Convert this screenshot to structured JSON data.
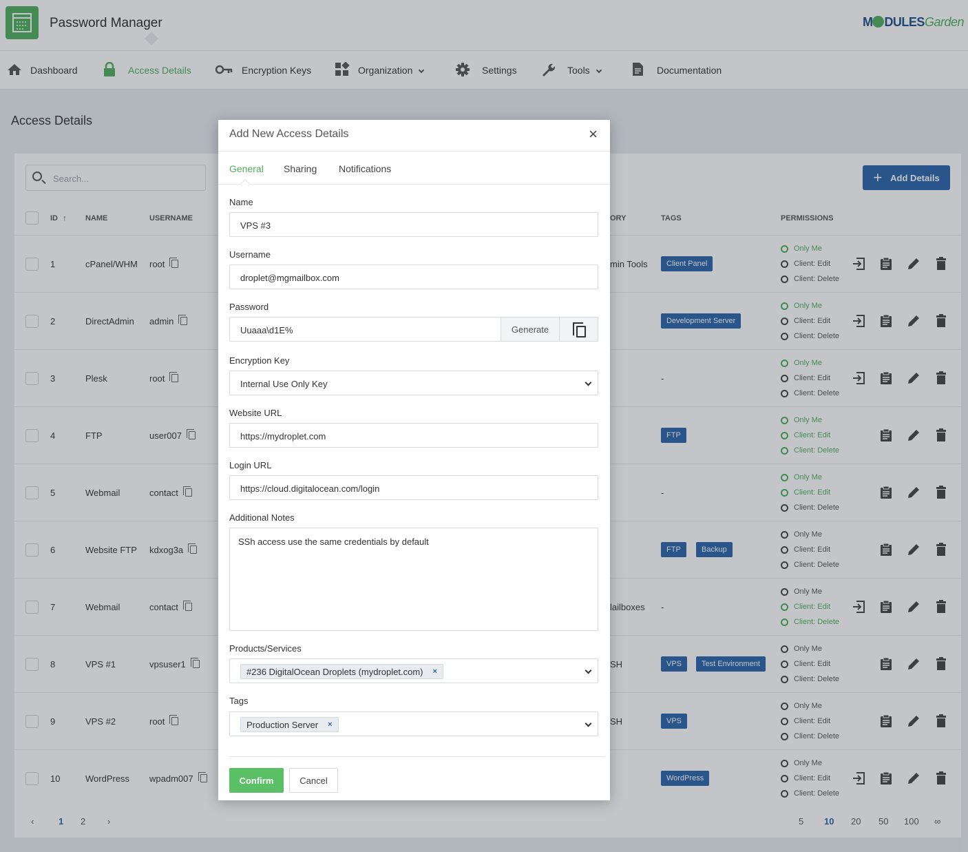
{
  "app": {
    "title": "Password Manager",
    "brand_a": "M",
    "brand_b": "DULES",
    "brand_c": "Garden"
  },
  "nav": [
    {
      "label": "Dashboard",
      "icon": "home-icon"
    },
    {
      "label": "Access Details",
      "icon": "lock-icon",
      "active": true
    },
    {
      "label": "Encryption Keys",
      "icon": "key-icon"
    },
    {
      "label": "Organization",
      "icon": "widgets-icon",
      "dropdown": true
    },
    {
      "label": "Settings",
      "icon": "gear-icon"
    },
    {
      "label": "Tools",
      "icon": "wrench-icon",
      "dropdown": true
    },
    {
      "label": "Documentation",
      "icon": "document-icon"
    }
  ],
  "page": {
    "title": "Access Details"
  },
  "toolbar": {
    "search_placeholder": "Search...",
    "add_label": "Add Details"
  },
  "table": {
    "headers": {
      "id": "ID",
      "name": "NAME",
      "username": "USERNAME",
      "category": "ORY",
      "tags": "TAGS",
      "permissions": "PERMISSIONS"
    },
    "rows": [
      {
        "id": "1",
        "name": "cPanel/WHM",
        "username": "root",
        "category": "min Tools",
        "tags": [
          "Client Panel"
        ],
        "perms": [
          true,
          false,
          false
        ],
        "login": true
      },
      {
        "id": "2",
        "name": "DirectAdmin",
        "username": "admin",
        "category": "",
        "tags": [
          "Development Server"
        ],
        "perms": [
          true,
          false,
          false
        ],
        "login": true
      },
      {
        "id": "3",
        "name": "Plesk",
        "username": "root",
        "category": "",
        "tags": [],
        "tag_empty": "-",
        "perms": [
          true,
          false,
          false
        ],
        "login": true
      },
      {
        "id": "4",
        "name": "FTP",
        "username": "user007",
        "category": "",
        "tags": [
          "FTP"
        ],
        "perms": [
          true,
          true,
          true
        ],
        "login": false
      },
      {
        "id": "5",
        "name": "Webmail",
        "username": "contact",
        "category": "",
        "tags": [],
        "tag_empty": "-",
        "perms": [
          true,
          true,
          false
        ],
        "login": false
      },
      {
        "id": "6",
        "name": "Website FTP",
        "username": "kdxog3a",
        "category": "",
        "tags": [
          "FTP",
          "Backup"
        ],
        "perms": [
          false,
          false,
          false
        ],
        "login": false
      },
      {
        "id": "7",
        "name": "Webmail",
        "username": "contact",
        "category": "lailboxes",
        "tags": [],
        "tag_empty": "-",
        "perms": [
          false,
          true,
          true
        ],
        "login": true
      },
      {
        "id": "8",
        "name": "VPS #1",
        "username": "vpsuser1",
        "category": "SH",
        "tags": [
          "VPS",
          "Test Environment"
        ],
        "perms": [
          false,
          false,
          false
        ],
        "login": false
      },
      {
        "id": "9",
        "name": "VPS #2",
        "username": "root",
        "category": "SH",
        "tags": [
          "VPS"
        ],
        "perms": [
          false,
          false,
          false
        ],
        "login": false
      },
      {
        "id": "10",
        "name": "WordPress",
        "username": "wpadm007",
        "category": "",
        "tags": [
          "WordPress"
        ],
        "perms": [
          false,
          false,
          false
        ],
        "login": true
      }
    ],
    "perm_labels": [
      "Only Me",
      "Client: Edit",
      "Client: Delete"
    ]
  },
  "pagination": {
    "pages": [
      "1",
      "2"
    ],
    "prev": "‹",
    "next": "›",
    "sizes": [
      "5",
      "10",
      "20",
      "50",
      "100",
      "∞"
    ],
    "active_size": "10"
  },
  "modal": {
    "title": "Add New Access Details",
    "close": "×",
    "tabs": [
      "General",
      "Sharing",
      "Notifications"
    ],
    "name_label": "Name",
    "name_value": "VPS #3",
    "username_label": "Username",
    "username_value": "droplet@mgmailbox.com",
    "password_label": "Password",
    "password_value": "Uuaaa\\d1E%",
    "generate_label": "Generate",
    "enc_label": "Encryption Key",
    "enc_value": "Internal Use Only Key",
    "website_label": "Website URL",
    "website_value": "https://mydroplet.com",
    "login_label": "Login URL",
    "login_value": "https://cloud.digitalocean.com/login",
    "notes_label": "Additional Notes",
    "notes_value": "SSh access use the same credentials by default",
    "products_label": "Products/Services",
    "products_value": "#236 DigitalOcean Droplets (mydroplet.com)",
    "tags_label": "Tags",
    "tags_value": "Production Server",
    "chip_remove": "×",
    "confirm": "Confirm",
    "cancel": "Cancel"
  },
  "colors": {
    "accent": "#4fae5c",
    "primary": "#2a65a8"
  }
}
